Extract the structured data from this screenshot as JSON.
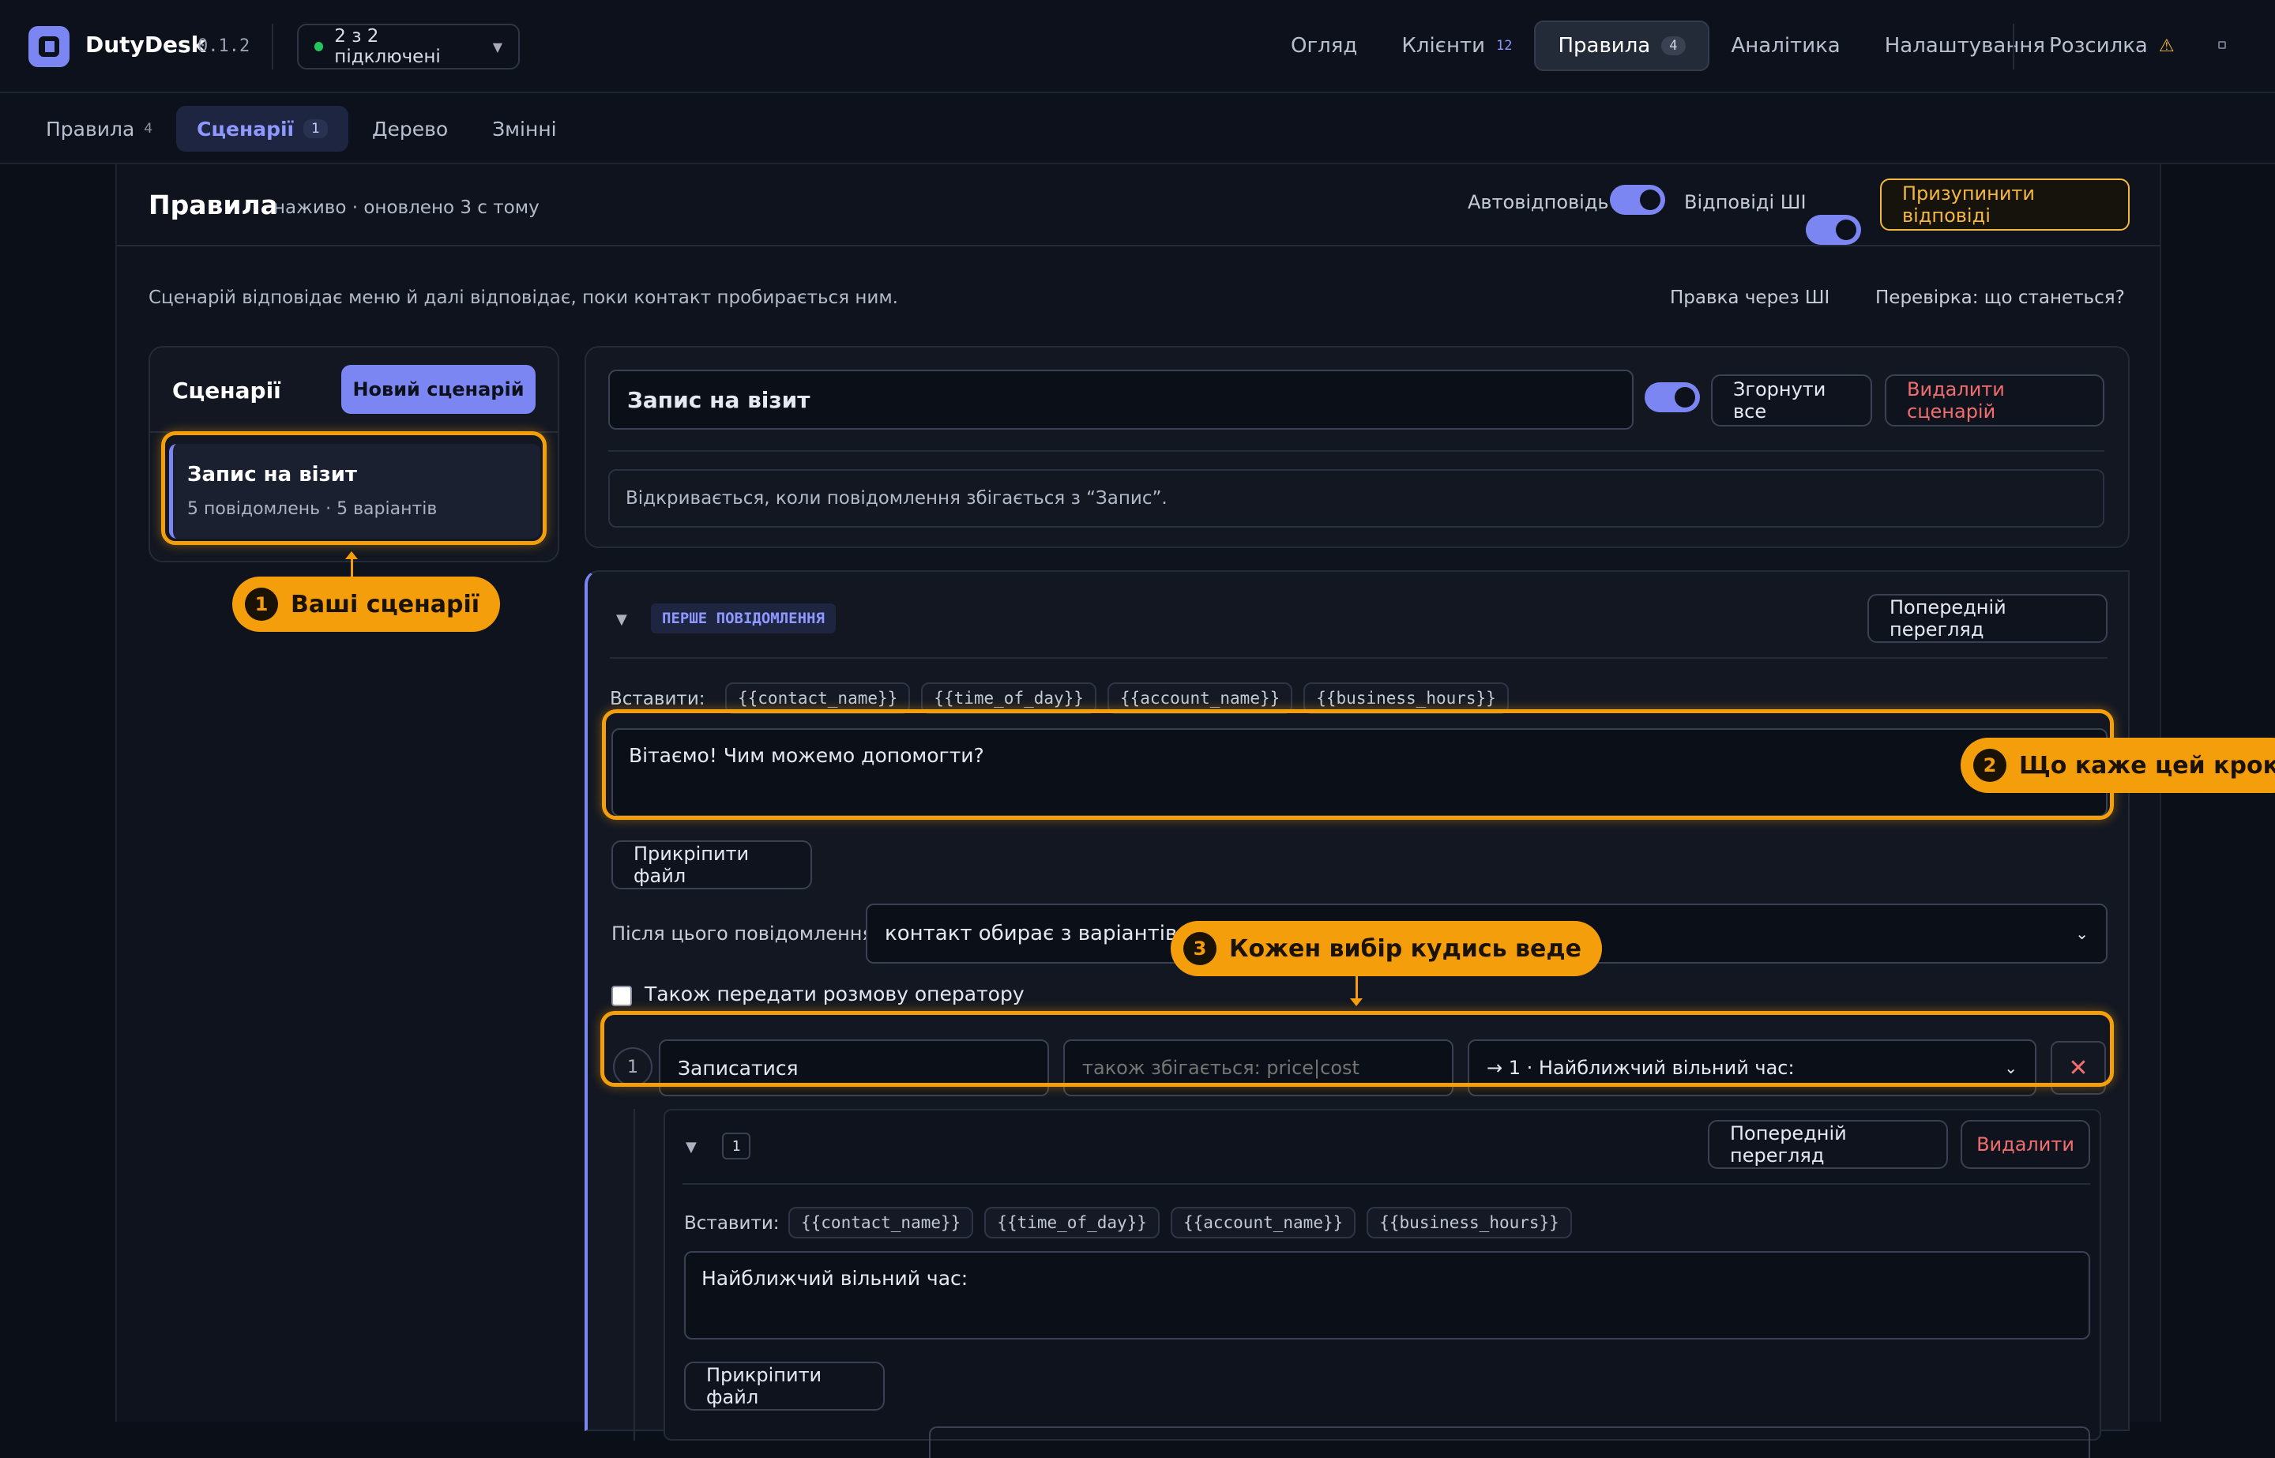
{
  "app": {
    "name": "DutyDesk",
    "version": "0.1.2",
    "connection_status": "2 з 2 підключені"
  },
  "nav": {
    "items": [
      {
        "label": "Огляд",
        "count": ""
      },
      {
        "label": "Клієнти",
        "count": "12"
      },
      {
        "label": "Правила",
        "count": "4"
      },
      {
        "label": "Аналітика",
        "count": ""
      },
      {
        "label": "Налаштування",
        "count": ""
      }
    ],
    "broadcast_label": "Розсилка",
    "broadcast_icon": "warning-icon",
    "active_index": 2
  },
  "subnav": {
    "tabs": [
      {
        "label": "Правила",
        "count": "4"
      },
      {
        "label": "Сценарії",
        "count": "1"
      },
      {
        "label": "Дерево",
        "count": ""
      },
      {
        "label": "Змінні",
        "count": ""
      }
    ],
    "active_index": 1
  },
  "header": {
    "title": "Правила",
    "status": "наживо · оновлено 3 с тому",
    "autoreply_label": "Автовідповідь",
    "ai_replies_label": "Відповіді ШІ",
    "pause_button": "Призупинити відповіді"
  },
  "description": "Сценарій відповідає меню й далі відповідає, поки контакт пробирається ним.",
  "actions": {
    "ai_edit": "Правка через ШІ",
    "check": "Перевірка: що станеться?"
  },
  "sidebar": {
    "title": "Сценарії",
    "new_button": "Новий сценарій",
    "scenarios": [
      {
        "name": "Запис на візит",
        "meta": "5 повідомлень · 5 варіантів"
      }
    ]
  },
  "editor": {
    "scenario_name": "Запис на візит",
    "collapse_all": "Згорнути все",
    "delete_scenario": "Видалити сценарій",
    "trigger_text": "Відкривається, коли повідомлення збігається з “Запис”.",
    "first_message": {
      "badge": "ПЕРШЕ ПОВІДОМЛЕННЯ",
      "preview_button": "Попередній перегляд",
      "insert_label": "Вставити:",
      "variables": [
        "{{contact_name}}",
        "{{time_of_day}}",
        "{{account_name}}",
        "{{business_hours}}"
      ],
      "text": "Вітаємо! Чим можемо допомогти?",
      "attach_button": "Прикріпити файл",
      "after_label": "Після цього повідомлення",
      "after_value": "контакт обирає з варіантів нижче",
      "handoff_label": "Також передати розмову оператору",
      "options": [
        {
          "num": "1",
          "label": "Записатися",
          "aliases_placeholder": "також збігається: price|cost",
          "target": "→ 1 · Найближчий вільний час:"
        }
      ]
    },
    "child_message": {
      "num": "1",
      "preview_button": "Попередній перегляд",
      "delete_button": "Видалити",
      "insert_label": "Вставити:",
      "variables": [
        "{{contact_name}}",
        "{{time_of_day}}",
        "{{account_name}}",
        "{{business_hours}}"
      ],
      "text": "Найближчий вільний час:",
      "attach_button": "Прикріпити файл"
    }
  },
  "callouts": [
    {
      "num": "1",
      "text": "Ваші сценарії"
    },
    {
      "num": "2",
      "text": "Що каже цей крок"
    },
    {
      "num": "3",
      "text": "Кожен вибір кудись веде"
    }
  ],
  "colors": {
    "accent": "#7c86f3",
    "highlight": "#f59e0b",
    "danger": "#f26d6d",
    "background": "#0b0f18"
  }
}
